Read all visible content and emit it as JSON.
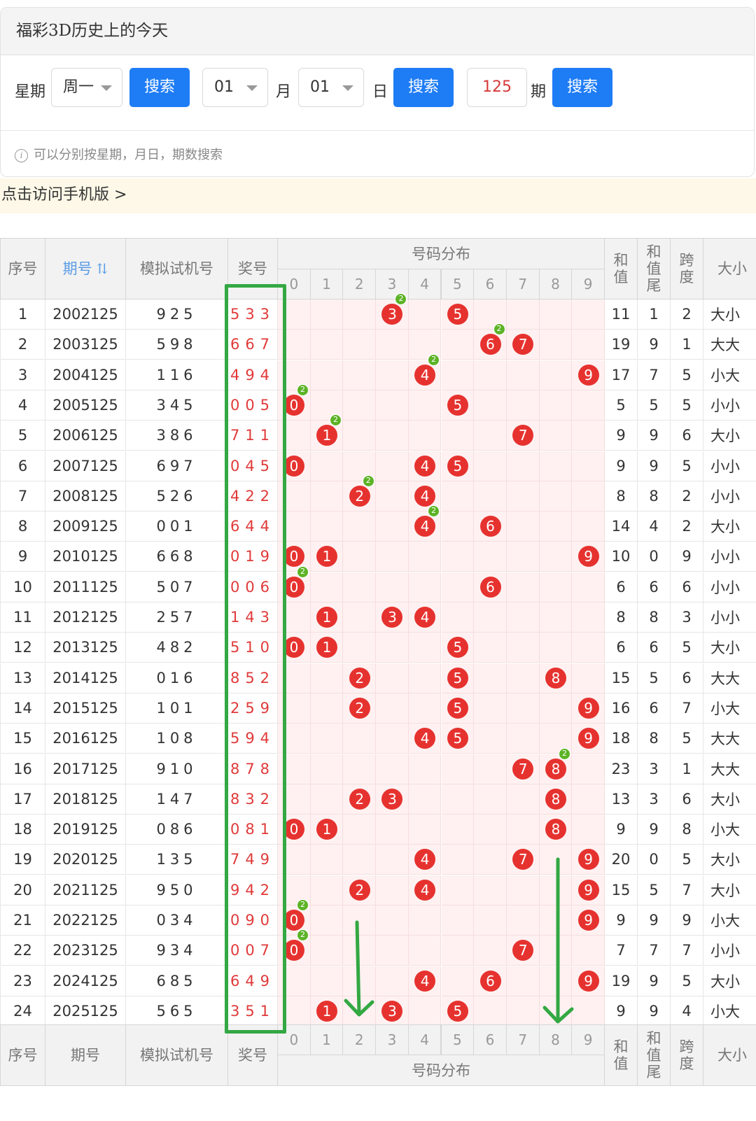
{
  "card": {
    "title": "福彩3D历史上的今天",
    "week_label": "星期",
    "week_value": "周一",
    "search_label": "搜索",
    "month_value": "01",
    "month_label": "月",
    "day_value": "01",
    "day_label": "日",
    "issue_value": "125",
    "issue_label": "期",
    "hint": "可以分别按星期，月日，期数搜索"
  },
  "mobile_link": "点击访问手机版 >",
  "table": {
    "headers": {
      "seq": "序号",
      "issue": "期号",
      "trial": "模拟试机号",
      "winning": "奖号",
      "distribution": "号码分布",
      "sum": "和值",
      "sum_tail": "和值尾",
      "span": "跨度",
      "size": "大小"
    },
    "digit_headers": [
      "0",
      "1",
      "2",
      "3",
      "4",
      "5",
      "6",
      "7",
      "8",
      "9"
    ],
    "repeat_badge": "2",
    "rows": [
      {
        "seq": "1",
        "issue": "2002125",
        "trial": "925",
        "win": "533",
        "sum": "11",
        "tail": "1",
        "span": "2",
        "size": "大小"
      },
      {
        "seq": "2",
        "issue": "2003125",
        "trial": "598",
        "win": "667",
        "sum": "19",
        "tail": "9",
        "span": "1",
        "size": "大大"
      },
      {
        "seq": "3",
        "issue": "2004125",
        "trial": "116",
        "win": "494",
        "sum": "17",
        "tail": "7",
        "span": "5",
        "size": "小大"
      },
      {
        "seq": "4",
        "issue": "2005125",
        "trial": "345",
        "win": "005",
        "sum": "5",
        "tail": "5",
        "span": "5",
        "size": "小小"
      },
      {
        "seq": "5",
        "issue": "2006125",
        "trial": "386",
        "win": "711",
        "sum": "9",
        "tail": "9",
        "span": "6",
        "size": "大小"
      },
      {
        "seq": "6",
        "issue": "2007125",
        "trial": "697",
        "win": "045",
        "sum": "9",
        "tail": "9",
        "span": "5",
        "size": "小小"
      },
      {
        "seq": "7",
        "issue": "2008125",
        "trial": "526",
        "win": "422",
        "sum": "8",
        "tail": "8",
        "span": "2",
        "size": "小小"
      },
      {
        "seq": "8",
        "issue": "2009125",
        "trial": "001",
        "win": "644",
        "sum": "14",
        "tail": "4",
        "span": "2",
        "size": "大小"
      },
      {
        "seq": "9",
        "issue": "2010125",
        "trial": "668",
        "win": "019",
        "sum": "10",
        "tail": "0",
        "span": "9",
        "size": "小小"
      },
      {
        "seq": "10",
        "issue": "2011125",
        "trial": "507",
        "win": "006",
        "sum": "6",
        "tail": "6",
        "span": "6",
        "size": "小小"
      },
      {
        "seq": "11",
        "issue": "2012125",
        "trial": "257",
        "win": "143",
        "sum": "8",
        "tail": "8",
        "span": "3",
        "size": "小小"
      },
      {
        "seq": "12",
        "issue": "2013125",
        "trial": "482",
        "win": "510",
        "sum": "6",
        "tail": "6",
        "span": "5",
        "size": "大小"
      },
      {
        "seq": "13",
        "issue": "2014125",
        "trial": "016",
        "win": "852",
        "sum": "15",
        "tail": "5",
        "span": "6",
        "size": "大大"
      },
      {
        "seq": "14",
        "issue": "2015125",
        "trial": "101",
        "win": "259",
        "sum": "16",
        "tail": "6",
        "span": "7",
        "size": "小大"
      },
      {
        "seq": "15",
        "issue": "2016125",
        "trial": "108",
        "win": "594",
        "sum": "18",
        "tail": "8",
        "span": "5",
        "size": "大大"
      },
      {
        "seq": "16",
        "issue": "2017125",
        "trial": "910",
        "win": "878",
        "sum": "23",
        "tail": "3",
        "span": "1",
        "size": "大大"
      },
      {
        "seq": "17",
        "issue": "2018125",
        "trial": "147",
        "win": "832",
        "sum": "13",
        "tail": "3",
        "span": "6",
        "size": "大小"
      },
      {
        "seq": "18",
        "issue": "2019125",
        "trial": "086",
        "win": "081",
        "sum": "9",
        "tail": "9",
        "span": "8",
        "size": "小大"
      },
      {
        "seq": "19",
        "issue": "2020125",
        "trial": "135",
        "win": "749",
        "sum": "20",
        "tail": "0",
        "span": "5",
        "size": "大小"
      },
      {
        "seq": "20",
        "issue": "2021125",
        "trial": "950",
        "win": "942",
        "sum": "15",
        "tail": "5",
        "span": "7",
        "size": "大小"
      },
      {
        "seq": "21",
        "issue": "2022125",
        "trial": "034",
        "win": "090",
        "sum": "9",
        "tail": "9",
        "span": "9",
        "size": "小大"
      },
      {
        "seq": "22",
        "issue": "2023125",
        "trial": "934",
        "win": "007",
        "sum": "7",
        "tail": "7",
        "span": "7",
        "size": "小小"
      },
      {
        "seq": "23",
        "issue": "2024125",
        "trial": "685",
        "win": "649",
        "sum": "19",
        "tail": "9",
        "span": "5",
        "size": "大小"
      },
      {
        "seq": "24",
        "issue": "2025125",
        "trial": "565",
        "win": "351",
        "sum": "9",
        "tail": "9",
        "span": "4",
        "size": "小大"
      }
    ]
  },
  "colors": {
    "ball": "#e6322f",
    "repeat_badge": "#5cb326",
    "highlight_box": "#33a843",
    "button": "#1e7cf5"
  }
}
